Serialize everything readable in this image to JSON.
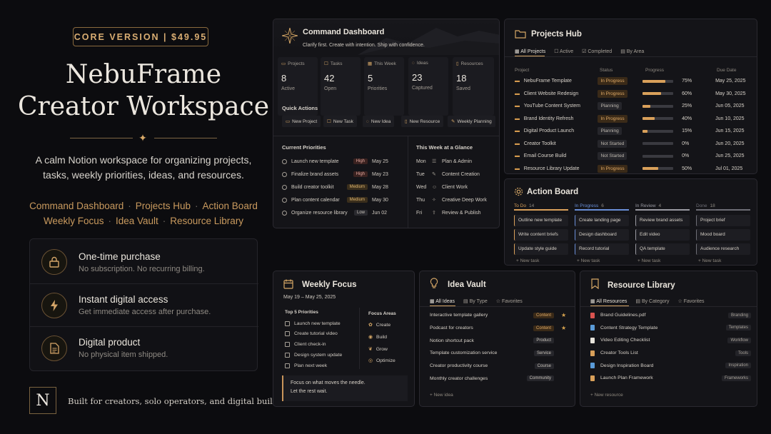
{
  "badge": "CORE VERSION  |  $49.95",
  "hero": {
    "title_line1": "NebuFrame",
    "title_line2": "Creator Workspace",
    "subtitle": "A calm Notion workspace for organizing projects, tasks, weekly priorities, ideas, and resources.",
    "modules_line1": [
      "Command Dashboard",
      "Projects Hub",
      "Action Board"
    ],
    "modules_line2": [
      "Weekly Focus",
      "Idea Vault",
      "Resource Library"
    ],
    "separator": "·"
  },
  "features": [
    {
      "title": "One-time purchase",
      "desc": "No subscription. No recurring billing.",
      "icon": "lock-icon"
    },
    {
      "title": "Instant digital access",
      "desc": "Get immediate access after purchase.",
      "icon": "lightning-icon"
    },
    {
      "title": "Digital product",
      "desc": "No physical item shipped.",
      "icon": "document-icon"
    }
  ],
  "footer": {
    "logo": "N",
    "text": "Built for creators, solo operators, and digital builders."
  },
  "colors": {
    "accent": "#d6a766",
    "background": "#0c0c0f",
    "card": "#141418"
  },
  "command": {
    "title": "Command Dashboard",
    "tagline": "Clarify first. Create with intention. Ship with confidence.",
    "stats": [
      {
        "label": "Projects",
        "num": "8",
        "sub": "Active"
      },
      {
        "label": "Tasks",
        "num": "42",
        "sub": "Open"
      },
      {
        "label": "This Week",
        "num": "5",
        "sub": "Priorities"
      },
      {
        "label": "Ideas",
        "num": "23",
        "sub": "Captured"
      },
      {
        "label": "Resources",
        "num": "18",
        "sub": "Saved"
      }
    ],
    "quick_actions_label": "Quick Actions",
    "quick_actions": [
      "New Project",
      "New Task",
      "New Idea",
      "New Resource",
      "Weekly Planning"
    ],
    "priorities_label": "Current Priorities",
    "priorities": [
      {
        "task": "Launch new template",
        "priority": "High",
        "date": "May 25"
      },
      {
        "task": "Finalize brand assets",
        "priority": "High",
        "date": "May 23"
      },
      {
        "task": "Build creator toolkit",
        "priority": "Medium",
        "date": "May 28"
      },
      {
        "task": "Plan content calendar",
        "priority": "Medium",
        "date": "May 30"
      },
      {
        "task": "Organize resource library",
        "priority": "Low",
        "date": "Jun 02"
      }
    ],
    "week_label": "This Week at a Glance",
    "week": [
      {
        "day": "Mon",
        "item": "Plan & Admin"
      },
      {
        "day": "Tue",
        "item": "Content Creation"
      },
      {
        "day": "Wed",
        "item": "Client Work"
      },
      {
        "day": "Thu",
        "item": "Creative Deep Work"
      },
      {
        "day": "Fri",
        "item": "Review & Publish"
      }
    ]
  },
  "projects": {
    "title": "Projects Hub",
    "tabs": [
      "All Projects",
      "Active",
      "Completed",
      "By Area"
    ],
    "headers": [
      "Project",
      "Status",
      "Progress",
      "Due Date"
    ],
    "rows": [
      {
        "name": "NebuFrame Template",
        "status": "In Progress",
        "progress": 75,
        "pct": "75%",
        "due": "May 25, 2025"
      },
      {
        "name": "Client Website Redesign",
        "status": "In Progress",
        "progress": 60,
        "pct": "60%",
        "due": "May 30, 2025"
      },
      {
        "name": "YouTube Content System",
        "status": "Planning",
        "progress": 25,
        "pct": "25%",
        "due": "Jun 05, 2025"
      },
      {
        "name": "Brand Identity Refresh",
        "status": "In Progress",
        "progress": 40,
        "pct": "40%",
        "due": "Jun 10, 2025"
      },
      {
        "name": "Digital Product Launch",
        "status": "Planning",
        "progress": 15,
        "pct": "15%",
        "due": "Jun 15, 2025"
      },
      {
        "name": "Creator Toolkit",
        "status": "Not Started",
        "progress": 0,
        "pct": "0%",
        "due": "Jun 20, 2025"
      },
      {
        "name": "Email Course Build",
        "status": "Not Started",
        "progress": 0,
        "pct": "0%",
        "due": "Jun 25, 2025"
      },
      {
        "name": "Resource Library Update",
        "status": "In Progress",
        "progress": 50,
        "pct": "50%",
        "due": "Jul 01, 2025"
      }
    ]
  },
  "action": {
    "title": "Action Board",
    "columns": [
      {
        "name": "To Do",
        "count": "14",
        "color": "#d9a05a",
        "tasks": [
          "Outline new template",
          "Write content briefs",
          "Update style guide"
        ]
      },
      {
        "name": "In Progress",
        "count": "6",
        "color": "#6a8fd8",
        "tasks": [
          "Create landing page",
          "Design dashboard",
          "Record tutorial"
        ]
      },
      {
        "name": "In Review",
        "count": "4",
        "color": "#9a9aa2",
        "tasks": [
          "Review brand assets",
          "Edit video",
          "QA template"
        ]
      },
      {
        "name": "Done",
        "count": "18",
        "color": "#6e6e76",
        "tasks": [
          "Project brief",
          "Mood board",
          "Audience research"
        ]
      }
    ],
    "new_task": "+ New task"
  },
  "focus": {
    "title": "Weekly Focus",
    "range": "May 19 – May 25, 2025",
    "top_label": "Top 5 Priorities",
    "priorities": [
      "Launch new template",
      "Create tutorial video",
      "Client check-in",
      "Design system update",
      "Plan next week"
    ],
    "areas_label": "Focus Areas",
    "areas": [
      {
        "name": "Create",
        "icon": "palette-icon"
      },
      {
        "name": "Build",
        "icon": "lightbulb-icon"
      },
      {
        "name": "Grow",
        "icon": "sprout-icon"
      },
      {
        "name": "Optimize",
        "icon": "target-icon"
      }
    ],
    "quote_line1": "Focus on what moves the needle.",
    "quote_line2": "Let the rest wait."
  },
  "ideas": {
    "title": "Idea Vault",
    "tabs": [
      "All Ideas",
      "By Type",
      "Favorites"
    ],
    "rows": [
      {
        "name": "Interactive template gallery",
        "tag": "Content",
        "star": "★"
      },
      {
        "name": "Podcast for creators",
        "tag": "Content",
        "star": "★"
      },
      {
        "name": "Notion shortcut pack",
        "tag": "Product",
        "star": ""
      },
      {
        "name": "Template customization service",
        "tag": "Service",
        "star": ""
      },
      {
        "name": "Creator productivity course",
        "tag": "Course",
        "star": ""
      },
      {
        "name": "Monthly creator challenges",
        "tag": "Community",
        "star": ""
      }
    ],
    "new_label": "+ New idea"
  },
  "resources": {
    "title": "Resource Library",
    "tabs": [
      "All Resources",
      "By Category",
      "Favorites"
    ],
    "rows": [
      {
        "name": "Brand Guidelines.pdf",
        "tag": "Branding",
        "color": "#d9534f"
      },
      {
        "name": "Content Strategy Template",
        "tag": "Templates",
        "color": "#5a9bd8"
      },
      {
        "name": "Video Editing Checklist",
        "tag": "Workflow",
        "color": "#e8e4dc"
      },
      {
        "name": "Creator Tools List",
        "tag": "Tools",
        "color": "#d9a05a"
      },
      {
        "name": "Design Inspiration Board",
        "tag": "Inspiration",
        "color": "#5a9bd8"
      },
      {
        "name": "Launch Plan Framework",
        "tag": "Frameworks",
        "color": "#d9a05a"
      }
    ],
    "new_label": "+ New resource"
  }
}
